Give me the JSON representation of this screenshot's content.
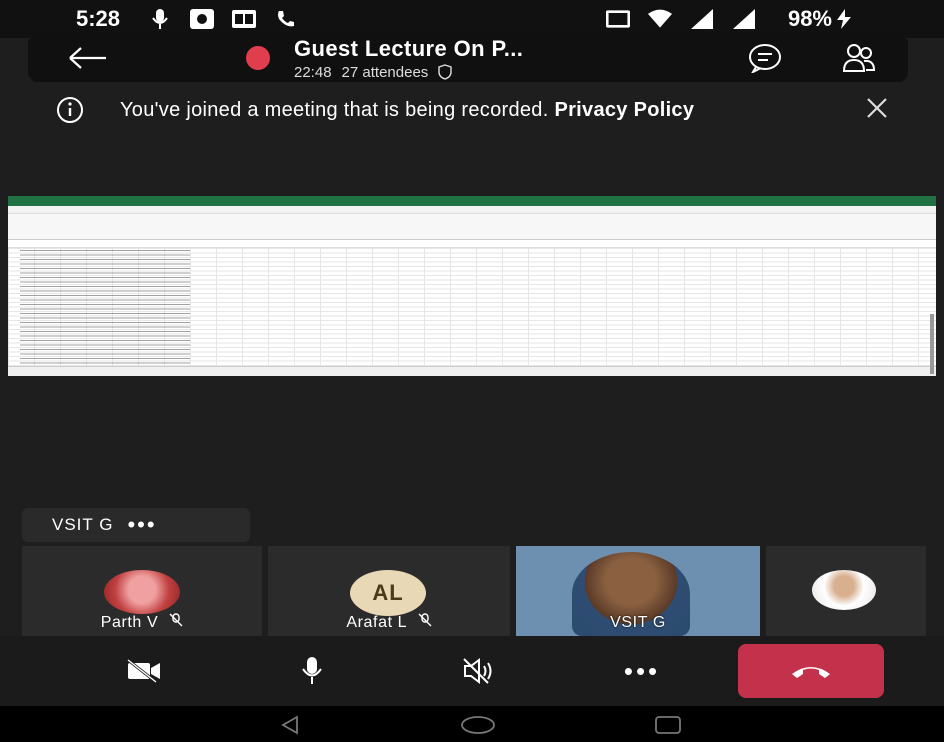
{
  "status_bar": {
    "time": "5:28",
    "battery": "98%",
    "icons": [
      "mic-icon",
      "app-icon",
      "card-icon",
      "phone-icon",
      "volte-icon",
      "wifi-icon",
      "signal-icon",
      "signal-icon",
      "charging-icon"
    ]
  },
  "call": {
    "title": "Guest Lecture On P...",
    "duration": "22:48",
    "attendees": "27 attendees",
    "recording_color": "#e03e4d"
  },
  "banner": {
    "text": "You've joined a meeting that is being recorded.",
    "link": "Privacy Policy"
  },
  "presenter_pill": {
    "name": "VSIT G",
    "more": "•••"
  },
  "participants": [
    {
      "name": "Parth V",
      "muted": true,
      "avatar": "photo"
    },
    {
      "name": "Arafat L",
      "initials": "AL",
      "muted": true,
      "avatar": "initials"
    },
    {
      "name": "VSIT G",
      "avatar": "video"
    },
    {
      "name": "",
      "avatar": "photo"
    }
  ],
  "controls": {
    "buttons": [
      "video-off-icon",
      "microphone-icon",
      "speaker-off-icon",
      "more-icon",
      "hang-up-icon"
    ],
    "more_label": "•••",
    "leave_color": "#c4314b"
  },
  "navigation": [
    "back-triangle-icon",
    "home-circle-icon",
    "recents-square-icon"
  ]
}
